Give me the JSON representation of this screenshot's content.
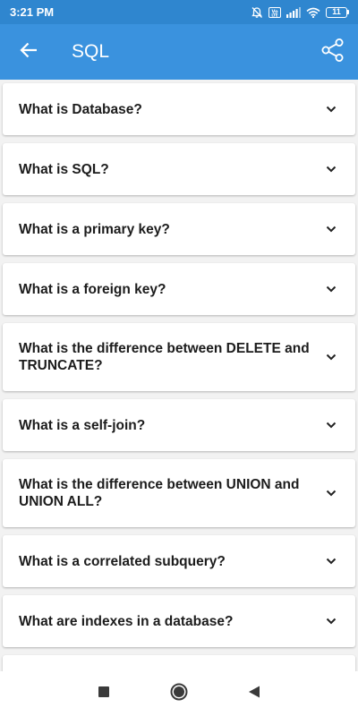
{
  "status_bar": {
    "time": "3:21 PM",
    "battery": "11",
    "icons": [
      "mute-icon",
      "volte-icon",
      "signal-icon",
      "wifi-icon",
      "battery-icon"
    ]
  },
  "app_bar": {
    "title": "SQL",
    "back_icon": "arrow-left-icon",
    "share_icon": "share-icon",
    "color": "#3a92de"
  },
  "questions": [
    {
      "text": "What is Database?"
    },
    {
      "text": "What is SQL?"
    },
    {
      "text": "What is a primary key?"
    },
    {
      "text": "What is a foreign key?"
    },
    {
      "text": "What is the difference between DELETE and TRUNCATE?"
    },
    {
      "text": "What is a self-join?"
    },
    {
      "text": "What is the difference between UNION and UNION ALL?"
    },
    {
      "text": "What is a correlated subquery?"
    },
    {
      "text": "What are indexes in a database?"
    }
  ],
  "nav_bar": {
    "buttons": [
      "recents-square-icon",
      "home-circle-icon",
      "back-triangle-icon"
    ]
  }
}
